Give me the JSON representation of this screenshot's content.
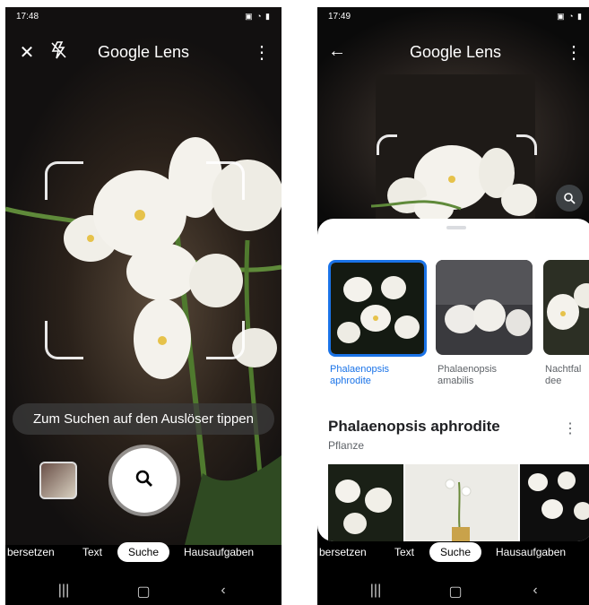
{
  "left": {
    "status_time": "17:48",
    "app_title": "Google Lens",
    "hint": "Zum Suchen auf den Auslöser tippen",
    "modes": [
      "bersetzen",
      "Text",
      "Suche",
      "Hausaufgaben"
    ],
    "active_mode": "Suche"
  },
  "right": {
    "status_time": "17:49",
    "app_title": "Google Lens",
    "results": [
      {
        "label_line1": "Phalaenopsis",
        "label_line2": "aphrodite",
        "selected": true
      },
      {
        "label_line1": "Phalaenopsis",
        "label_line2": "amabilis",
        "selected": false
      },
      {
        "label_line1": "Nachtfal",
        "label_line2": "dee",
        "selected": false
      }
    ],
    "result_title": "Phalaenopsis aphrodite",
    "result_subtitle": "Pflanze",
    "modes": [
      "bersetzen",
      "Text",
      "Suche",
      "Hausaufgaben"
    ],
    "active_mode": "Suche"
  },
  "colors": {
    "accent": "#1a73e8",
    "background": "#000000",
    "sheet": "#ffffff"
  },
  "icons": [
    "close-icon",
    "flash-off-icon",
    "more-vert-icon",
    "back-arrow-icon",
    "search-icon",
    "gallery-icon",
    "lens-search-icon",
    "recents-nav-icon",
    "home-nav-icon",
    "back-nav-icon"
  ]
}
